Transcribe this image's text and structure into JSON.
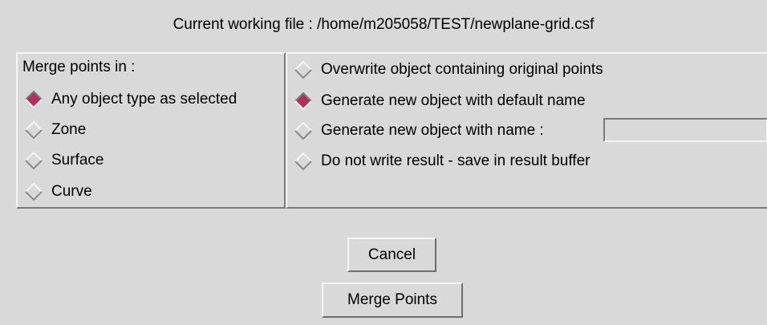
{
  "header": {
    "working_file": "Current working file : /home/m205058/TEST/newplane-grid.csf"
  },
  "merge_in": {
    "title": "Merge points in :",
    "options": [
      {
        "label": "Any object type as selected",
        "selected": true
      },
      {
        "label": "Zone",
        "selected": false
      },
      {
        "label": "Surface",
        "selected": false
      },
      {
        "label": "Curve",
        "selected": false
      }
    ]
  },
  "output": {
    "options": [
      {
        "label": "Overwrite object containing original points",
        "selected": false
      },
      {
        "label": "Generate new object with default name",
        "selected": true
      },
      {
        "label": "Generate new object with name :",
        "selected": false
      },
      {
        "label": "Do not write result - save in result buffer",
        "selected": false
      }
    ],
    "name_value": ""
  },
  "buttons": {
    "cancel": "Cancel",
    "merge": "Merge Points"
  },
  "colors": {
    "background": "#d9d9d9",
    "radio_selected": "#b03060",
    "highlight": "#f5f5f5",
    "shadow": "#7a7a7a"
  },
  "icons": {
    "radio": "diamond-radio-icon"
  }
}
